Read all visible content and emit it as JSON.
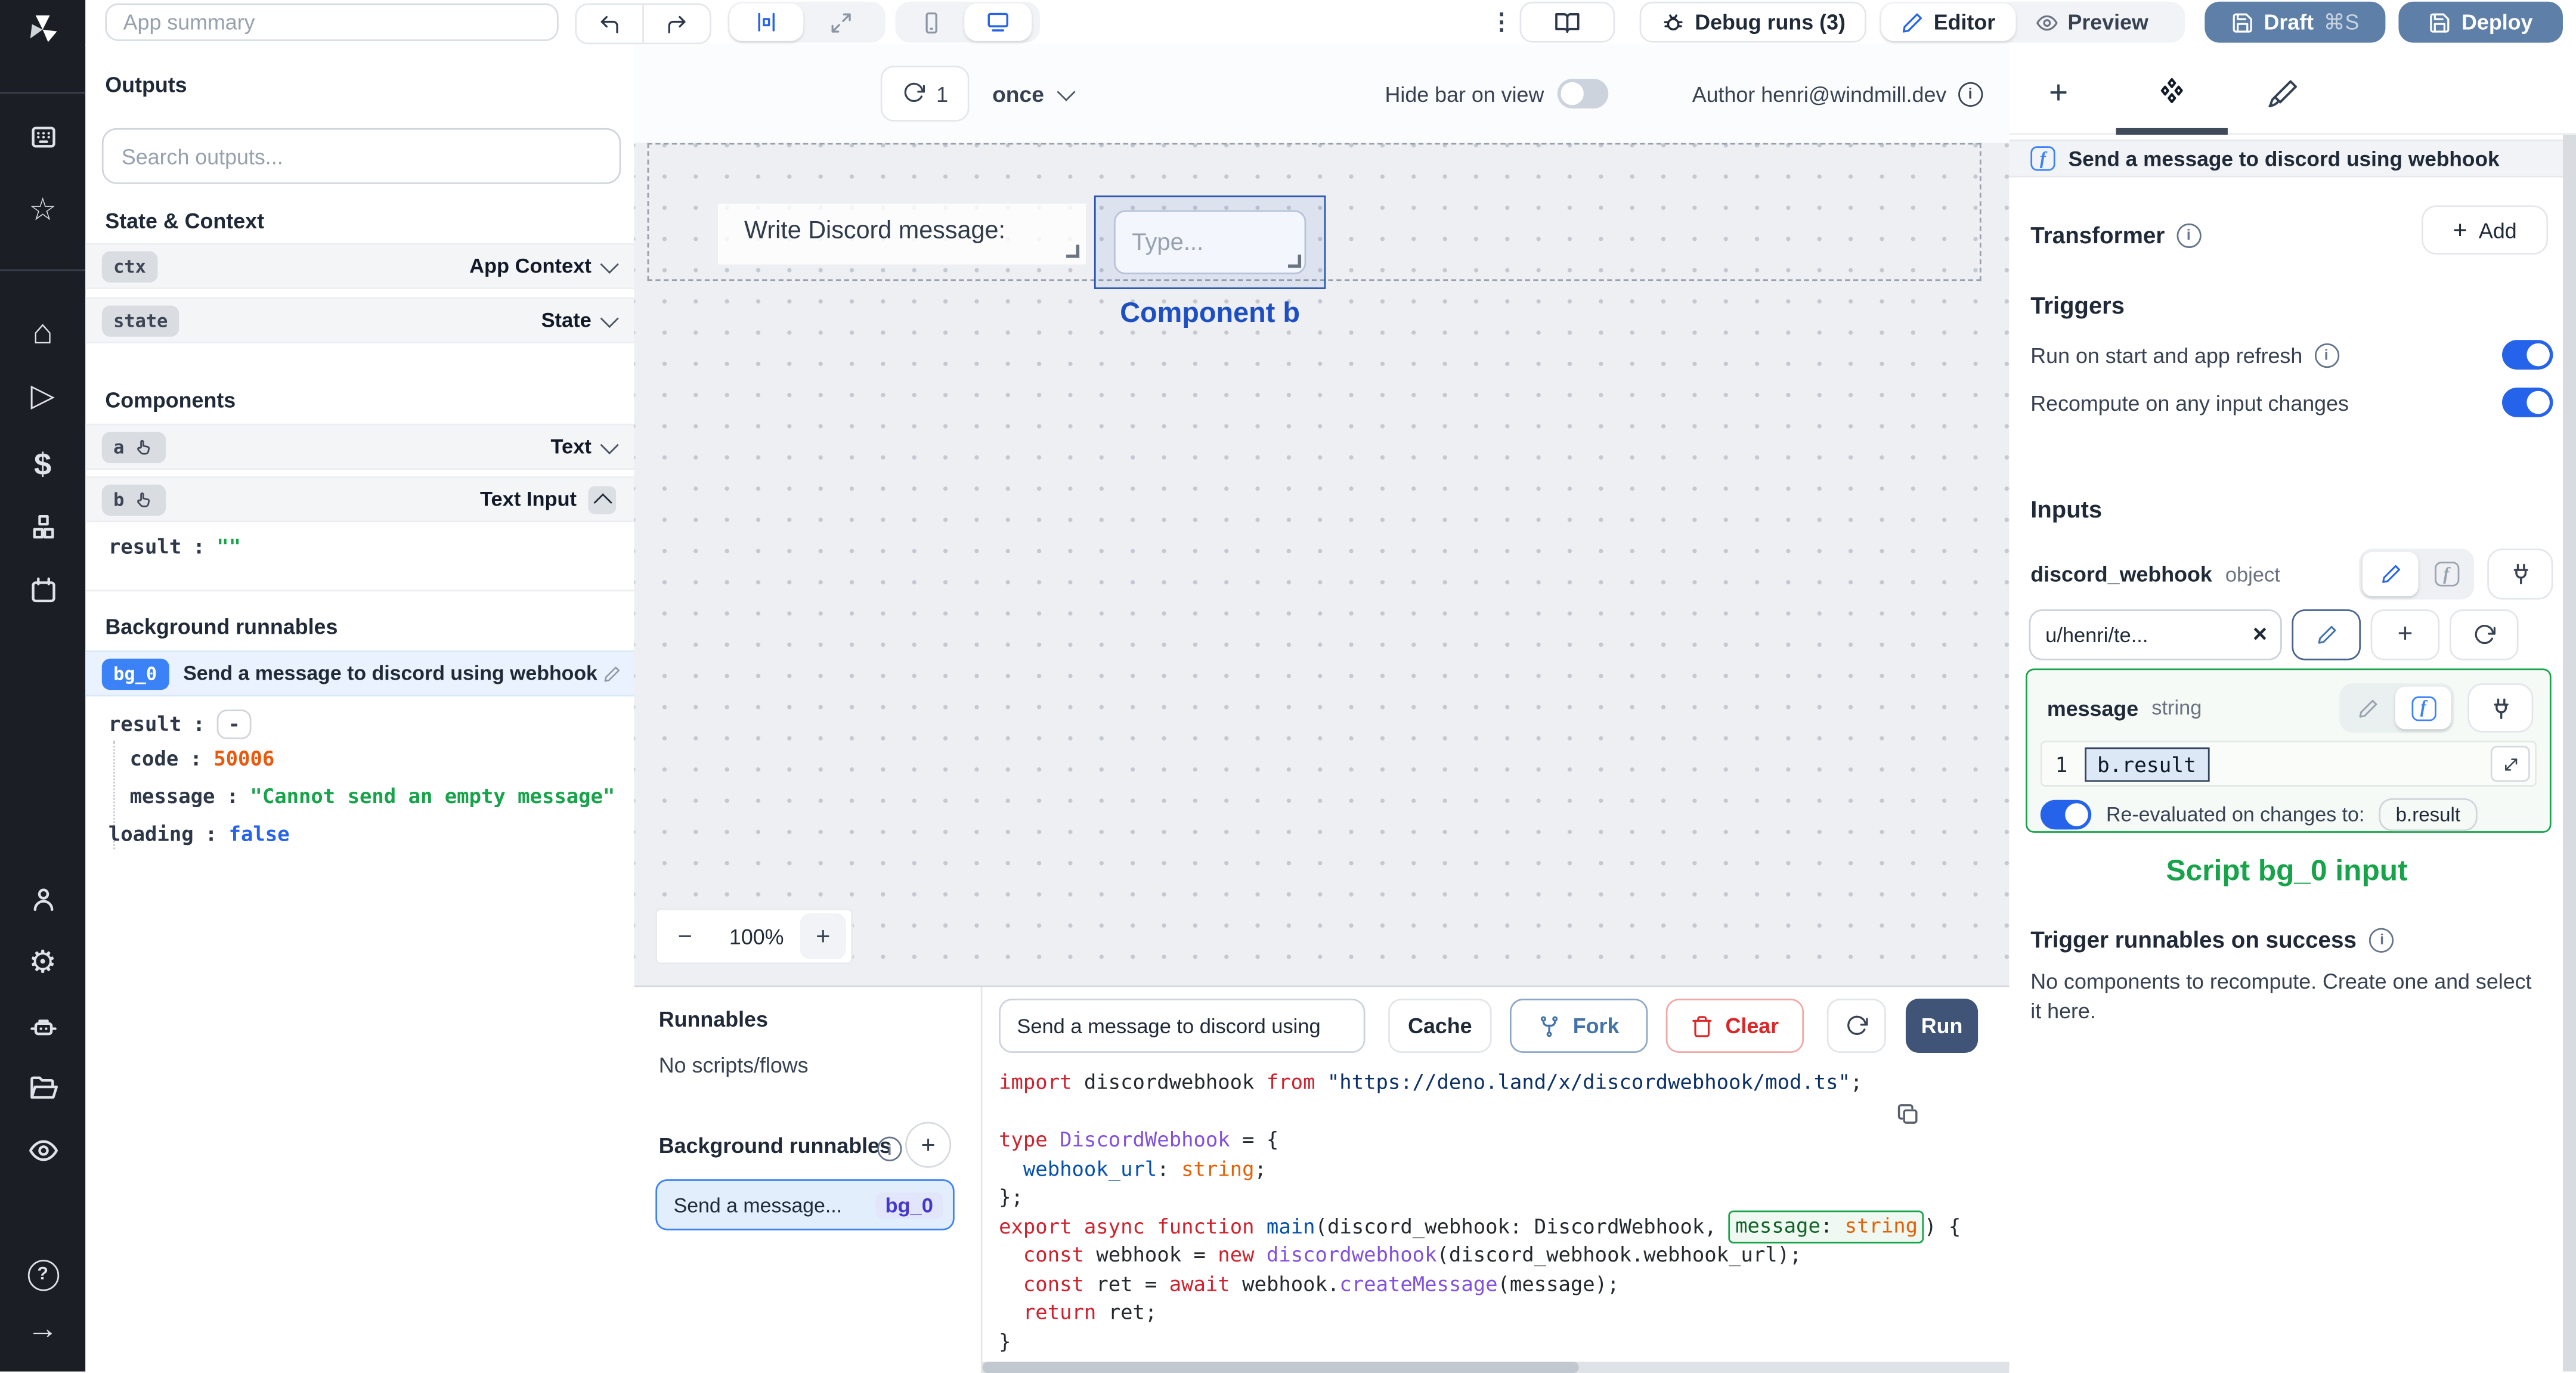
{
  "icons": {
    "kebab": "⋮",
    "star": "☆",
    "home": "⌂",
    "play": "▷",
    "dollar": "$",
    "gear": "⚙",
    "arrow_right": "→",
    "help": "?",
    "plus": "+",
    "minus": "−",
    "close": "×",
    "colon": ":",
    "f": "f",
    "one": "1"
  },
  "topbar": {
    "app_summary_placeholder": "App summary",
    "debug_runs_label": "Debug runs (3)",
    "editor_label": "Editor",
    "preview_label": "Preview",
    "draft_label": "Draft",
    "draft_shortcut": "⌘S",
    "deploy_label": "Deploy"
  },
  "outputs": {
    "title": "Outputs",
    "search_placeholder": "Search outputs...",
    "state_context_title": "State & Context",
    "ctx": {
      "key": "ctx",
      "type": "App Context"
    },
    "state": {
      "key": "state",
      "type": "State"
    },
    "components_title": "Components",
    "comp_a": {
      "key": "a",
      "type": "Text"
    },
    "comp_b": {
      "key": "b",
      "type": "Text Input",
      "result_key": "result",
      "result_value": "\"\""
    },
    "background_title": "Background runnables",
    "bg0": {
      "key": "bg_0",
      "label": "Send a message to discord using webhook",
      "result_key": "result",
      "result_value": "-",
      "code_key": "code",
      "code_value": "50006",
      "message_key": "message",
      "message_value": "\"Cannot send an empty message\"",
      "loading_key": "loading",
      "loading_value": "false"
    }
  },
  "canvas": {
    "refresh_count": "1",
    "frequency": "once",
    "hide_bar_label": "Hide bar on view",
    "author_label": "Author henri@windmill.dev",
    "text_component": "Write Discord message:",
    "input_placeholder": "Type...",
    "selection_label": "Component b",
    "zoom_level": "100%"
  },
  "runnables": {
    "title": "Runnables",
    "empty": "No scripts/flows",
    "background_title": "Background runnables",
    "item": {
      "label": "Send a message...",
      "id": "bg_0"
    }
  },
  "runbar": {
    "script_name": "Send a message to discord using",
    "cache_label": "Cache",
    "fork_label": "Fork",
    "clear_label": "Clear",
    "run_label": "Run"
  },
  "code": {
    "lines": [
      [
        {
          "c": "k",
          "t": "import"
        },
        {
          "c": "p",
          "t": " discordwebhook "
        },
        {
          "c": "k",
          "t": "from"
        },
        {
          "c": "p",
          "t": " "
        },
        {
          "c": "s",
          "t": "\"https://deno.land/x/discordwebhook/mod.ts\""
        },
        {
          "c": "p",
          "t": ";"
        }
      ],
      [],
      [
        {
          "c": "k",
          "t": "type"
        },
        {
          "c": "p",
          "t": " "
        },
        {
          "c": "t",
          "t": "DiscordWebhook"
        },
        {
          "c": "p",
          "t": " = {"
        }
      ],
      [
        {
          "c": "p",
          "t": "  "
        },
        {
          "c": "b",
          "t": "webhook_url"
        },
        {
          "c": "p",
          "t": ": "
        },
        {
          "c": "o",
          "t": "string"
        },
        {
          "c": "p",
          "t": ";"
        }
      ],
      [
        {
          "c": "p",
          "t": "};"
        }
      ],
      [
        {
          "c": "k",
          "t": "export"
        },
        {
          "c": "p",
          "t": " "
        },
        {
          "c": "k",
          "t": "async"
        },
        {
          "c": "p",
          "t": " "
        },
        {
          "c": "k",
          "t": "function"
        },
        {
          "c": "p",
          "t": " "
        },
        {
          "c": "b",
          "t": "main"
        },
        {
          "c": "p",
          "t": "(discord_webhook: DiscordWebhook, "
        },
        {
          "c": "g",
          "t": "message",
          "w": true
        },
        {
          "c": "p",
          "t": ": ",
          "w": true
        },
        {
          "c": "o",
          "t": "string",
          "w": true
        },
        {
          "c": "p",
          "t": ") {"
        }
      ],
      [
        {
          "c": "p",
          "t": "  "
        },
        {
          "c": "k",
          "t": "const"
        },
        {
          "c": "p",
          "t": " webhook = "
        },
        {
          "c": "k",
          "t": "new"
        },
        {
          "c": "p",
          "t": " "
        },
        {
          "c": "t",
          "t": "discordwebhook"
        },
        {
          "c": "p",
          "t": "(discord_webhook.webhook_url);"
        }
      ],
      [
        {
          "c": "p",
          "t": "  "
        },
        {
          "c": "k",
          "t": "const"
        },
        {
          "c": "p",
          "t": " ret = "
        },
        {
          "c": "k",
          "t": "await"
        },
        {
          "c": "p",
          "t": " webhook."
        },
        {
          "c": "t",
          "t": "createMessage"
        },
        {
          "c": "p",
          "t": "(message);"
        }
      ],
      [
        {
          "c": "p",
          "t": "  "
        },
        {
          "c": "k",
          "t": "return"
        },
        {
          "c": "p",
          "t": " ret;"
        }
      ],
      [
        {
          "c": "p",
          "t": "}"
        }
      ]
    ]
  },
  "panel": {
    "header": "Send a message to discord using webhook",
    "transformer_label": "Transformer",
    "add_label": "Add",
    "triggers_title": "Triggers",
    "trigger_start": "Run on start and app refresh",
    "trigger_recompute": "Recompute on any input changes",
    "inputs_title": "Inputs",
    "discord_webhook": {
      "name": "discord_webhook",
      "type": "object",
      "value": "u/henri/te..."
    },
    "message": {
      "name": "message",
      "type": "string",
      "line_number": "1",
      "expression": "b.result",
      "reeval_label": "Re-evaluated on changes to:",
      "reeval_target": "b.result"
    },
    "script_input_caption": "Script bg_0 input",
    "success_title": "Trigger runnables on success",
    "success_empty": "No components to recompute. Create one and select it here."
  }
}
